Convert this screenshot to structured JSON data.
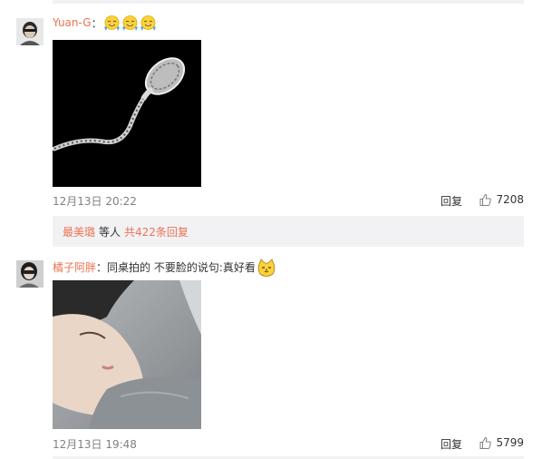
{
  "comments": [
    {
      "username": "Yuan-G",
      "separator": "：",
      "text": "",
      "emojis": [
        "laughing-crying-emoji",
        "laughing-crying-emoji",
        "laughing-crying-emoji"
      ],
      "image": "sperm-xray-image",
      "time": "12月13日 20:22",
      "reply_label": "回复",
      "likes": "7208",
      "replies": {
        "user": "最美璐",
        "middle": "等人",
        "total": "共422条回复"
      }
    },
    {
      "username": "橘子阿胖",
      "separator": "：",
      "text": "同桌拍的 不要脸的说句:真好看",
      "emojis": [
        "cat-smirk-emoji"
      ],
      "image": "sleeping-girl-photo",
      "time": "12月13日 19:48",
      "reply_label": "回复",
      "likes": "5799"
    }
  ],
  "colors": {
    "link": "#eb7350",
    "meta": "#808080",
    "subbar_bg": "#f2f2f5"
  }
}
